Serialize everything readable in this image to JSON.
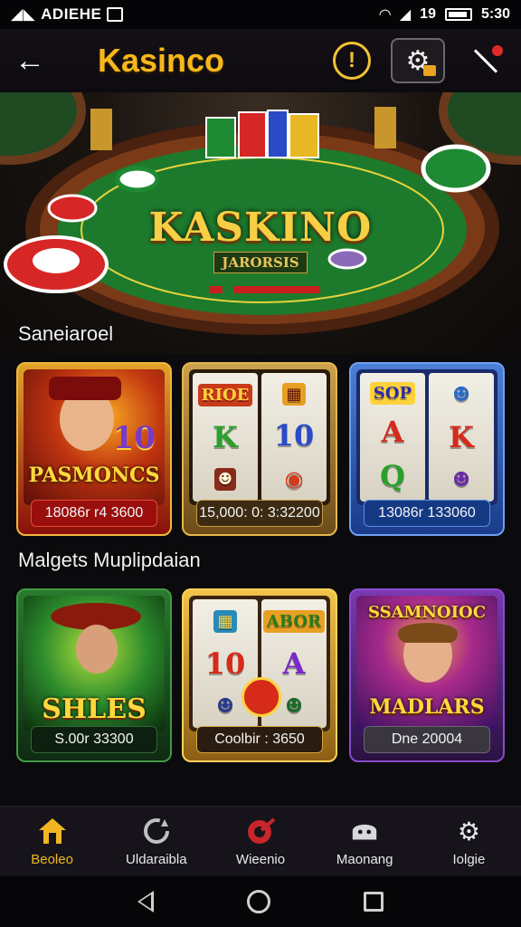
{
  "status_bar": {
    "left_text": "ADIEHE",
    "right_text": "19",
    "time": "5:30"
  },
  "header": {
    "title": "Kasinco",
    "info_icon": "info-circle-icon",
    "settings_icon": "gear-lock-icon",
    "mute_icon": "mute-icon",
    "accent": "#f6b81a"
  },
  "hero": {
    "logo": "KASKINO",
    "sub": "JARORSIS"
  },
  "sections": [
    {
      "label": "Saneiaroel",
      "cards": [
        {
          "title": "PASMONCS",
          "meta": "18086r r4 3600"
        },
        {
          "title": "RIOE",
          "meta": "15,000: 0: 3:32200"
        },
        {
          "title": "SOP",
          "meta": "13086r 133060"
        }
      ]
    },
    {
      "label": "Malgets Muplipdaian",
      "cards": [
        {
          "title": "SHLES",
          "meta": "S.00r 33300"
        },
        {
          "title": "ABOR",
          "meta": "Coolbir : 3650"
        },
        {
          "title": "MADLARS",
          "top": "SSAMNOIOC",
          "meta": "Dne 20004"
        }
      ]
    }
  ],
  "bottom_nav": [
    {
      "label": "Beoleo",
      "icon": "home-icon",
      "active": true
    },
    {
      "label": "Uldaraibla",
      "icon": "refresh-icon",
      "active": false
    },
    {
      "label": "Wieenio",
      "icon": "target-icon",
      "active": false
    },
    {
      "label": "Maonang",
      "icon": "chat-icon",
      "active": false
    },
    {
      "label": "Iolgie",
      "icon": "gear-icon",
      "active": false
    }
  ],
  "system_nav": [
    "back-icon",
    "home-circle-icon",
    "recents-icon"
  ]
}
